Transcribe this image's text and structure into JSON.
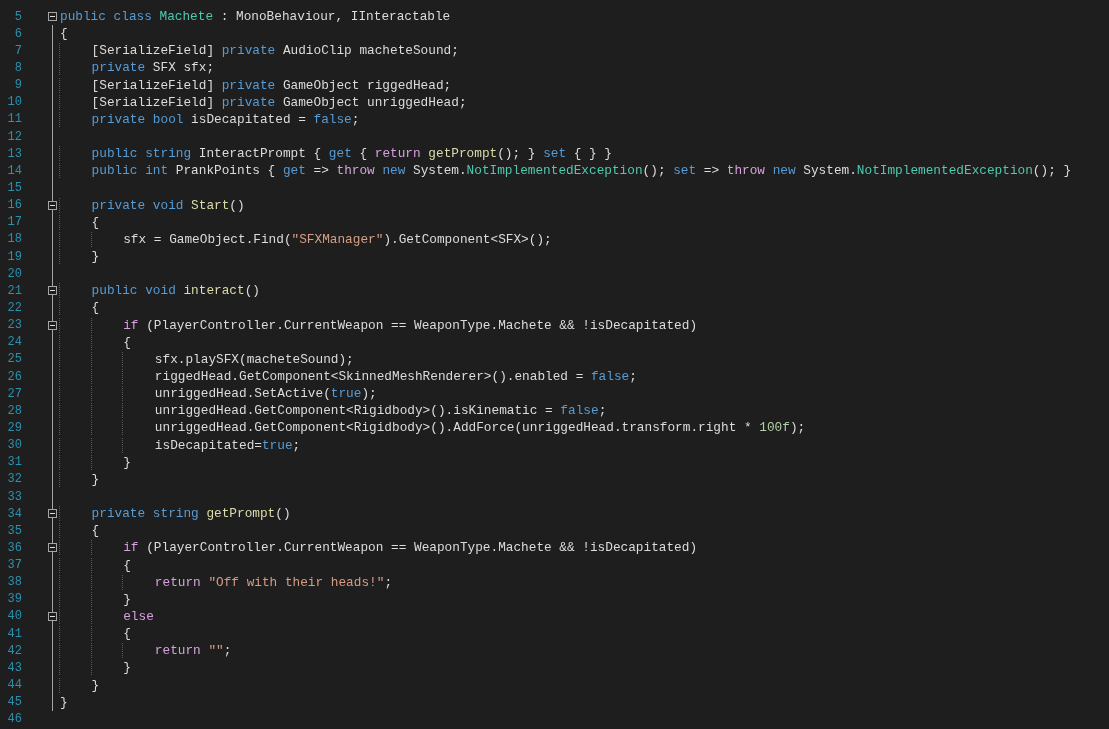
{
  "editor": {
    "lines": [
      {
        "number": "5",
        "fold_marker": true,
        "tokens": [
          {
            "kind": "keyword",
            "text": "public"
          },
          {
            "kind": "keyword",
            "text": " class"
          },
          {
            "kind": "type",
            "text": " Machete"
          },
          {
            "kind": "plain",
            "text": " : MonoBehaviour, IInteractable"
          }
        ]
      },
      {
        "number": "6",
        "fold_marker": false,
        "tokens": [
          {
            "kind": "plain",
            "text": "{"
          }
        ]
      },
      {
        "number": "7",
        "fold_marker": false,
        "tokens": [
          {
            "kind": "plain",
            "text": "    [SerializeField]"
          },
          {
            "kind": "keyword",
            "text": " private"
          },
          {
            "kind": "plain",
            "text": " AudioClip macheteSound;"
          }
        ]
      },
      {
        "number": "8",
        "fold_marker": false,
        "tokens": [
          {
            "kind": "keyword",
            "text": "    private"
          },
          {
            "kind": "plain",
            "text": " SFX sfx;"
          }
        ]
      },
      {
        "number": "9",
        "fold_marker": false,
        "tokens": [
          {
            "kind": "plain",
            "text": "    [SerializeField]"
          },
          {
            "kind": "keyword",
            "text": " private"
          },
          {
            "kind": "plain",
            "text": " GameObject riggedHead;"
          }
        ]
      },
      {
        "number": "10",
        "fold_marker": false,
        "tokens": [
          {
            "kind": "plain",
            "text": "    [SerializeField]"
          },
          {
            "kind": "keyword",
            "text": " private"
          },
          {
            "kind": "plain",
            "text": " GameObject unriggedHead;"
          }
        ]
      },
      {
        "number": "11",
        "fold_marker": false,
        "tokens": [
          {
            "kind": "keyword",
            "text": "    private"
          },
          {
            "kind": "keyword",
            "text": " bool"
          },
          {
            "kind": "plain",
            "text": " isDecapitated = "
          },
          {
            "kind": "keyword",
            "text": "false"
          },
          {
            "kind": "plain",
            "text": ";"
          }
        ]
      },
      {
        "number": "12",
        "fold_marker": false
      },
      {
        "number": "13",
        "fold_marker": false,
        "tokens": [
          {
            "kind": "keyword",
            "text": "    public"
          },
          {
            "kind": "keyword",
            "text": " string"
          },
          {
            "kind": "plain",
            "text": " InteractPrompt { "
          },
          {
            "kind": "keyword",
            "text": "get"
          },
          {
            "kind": "plain",
            "text": " { "
          },
          {
            "kind": "control",
            "text": "return"
          },
          {
            "kind": "method",
            "text": " getPrompt"
          },
          {
            "kind": "plain",
            "text": "(); } "
          },
          {
            "kind": "keyword",
            "text": "set"
          },
          {
            "kind": "plain",
            "text": " { } }"
          }
        ]
      },
      {
        "number": "14",
        "fold_marker": false,
        "tokens": [
          {
            "kind": "keyword",
            "text": "    public"
          },
          {
            "kind": "keyword",
            "text": " int"
          },
          {
            "kind": "plain",
            "text": " PrankPoints { "
          },
          {
            "kind": "keyword",
            "text": "get"
          },
          {
            "kind": "plain",
            "text": " => "
          },
          {
            "kind": "control",
            "text": "throw"
          },
          {
            "kind": "keyword",
            "text": " new"
          },
          {
            "kind": "plain",
            "text": " System."
          },
          {
            "kind": "type",
            "text": "NotImplementedException"
          },
          {
            "kind": "plain",
            "text": "(); "
          },
          {
            "kind": "keyword",
            "text": "set"
          },
          {
            "kind": "plain",
            "text": " => "
          },
          {
            "kind": "control",
            "text": "throw"
          },
          {
            "kind": "keyword",
            "text": " new"
          },
          {
            "kind": "plain",
            "text": " System."
          },
          {
            "kind": "type",
            "text": "NotImplementedException"
          },
          {
            "kind": "plain",
            "text": "(); }"
          }
        ]
      },
      {
        "number": "15",
        "fold_marker": false
      },
      {
        "number": "16",
        "fold_marker": true,
        "tokens": [
          {
            "kind": "keyword",
            "text": "    private"
          },
          {
            "kind": "keyword",
            "text": " void"
          },
          {
            "kind": "method",
            "text": " Start"
          },
          {
            "kind": "plain",
            "text": "()"
          }
        ]
      },
      {
        "number": "17",
        "fold_marker": false,
        "tokens": [
          {
            "kind": "plain",
            "text": "    {"
          }
        ]
      },
      {
        "number": "18",
        "fold_marker": false,
        "tokens": [
          {
            "kind": "plain",
            "text": "        sfx = GameObject.Find("
          },
          {
            "kind": "string",
            "text": "\"SFXManager\""
          },
          {
            "kind": "plain",
            "text": ").GetComponent<SFX>();"
          }
        ]
      },
      {
        "number": "19",
        "fold_marker": false,
        "tokens": [
          {
            "kind": "plain",
            "text": "    }"
          }
        ]
      },
      {
        "number": "20",
        "fold_marker": false
      },
      {
        "number": "21",
        "fold_marker": true,
        "tokens": [
          {
            "kind": "keyword",
            "text": "    public"
          },
          {
            "kind": "keyword",
            "text": " void"
          },
          {
            "kind": "method",
            "text": " interact"
          },
          {
            "kind": "plain",
            "text": "()"
          }
        ]
      },
      {
        "number": "22",
        "fold_marker": false,
        "tokens": [
          {
            "kind": "plain",
            "text": "    {"
          }
        ]
      },
      {
        "number": "23",
        "fold_marker": true,
        "tokens": [
          {
            "kind": "control",
            "text": "        if"
          },
          {
            "kind": "plain",
            "text": " (PlayerController.CurrentWeapon == WeaponType.Machete && !isDecapitated)"
          }
        ]
      },
      {
        "number": "24",
        "fold_marker": false,
        "tokens": [
          {
            "kind": "plain",
            "text": "        {"
          }
        ]
      },
      {
        "number": "25",
        "fold_marker": false,
        "tokens": [
          {
            "kind": "plain",
            "text": "            sfx.playSFX(macheteSound);"
          }
        ]
      },
      {
        "number": "26",
        "fold_marker": false,
        "tokens": [
          {
            "kind": "plain",
            "text": "            riggedHead.GetComponent<SkinnedMeshRenderer>().enabled = "
          },
          {
            "kind": "keyword",
            "text": "false"
          },
          {
            "kind": "plain",
            "text": ";"
          }
        ]
      },
      {
        "number": "27",
        "fold_marker": false,
        "tokens": [
          {
            "kind": "plain",
            "text": "            unriggedHead.SetActive("
          },
          {
            "kind": "keyword",
            "text": "true"
          },
          {
            "kind": "plain",
            "text": ");"
          }
        ]
      },
      {
        "number": "28",
        "fold_marker": false,
        "tokens": [
          {
            "kind": "plain",
            "text": "            unriggedHead.GetComponent<Rigidbody>().isKinematic = "
          },
          {
            "kind": "keyword",
            "text": "false"
          },
          {
            "kind": "plain",
            "text": ";"
          }
        ]
      },
      {
        "number": "29",
        "fold_marker": false,
        "tokens": [
          {
            "kind": "plain",
            "text": "            unriggedHead.GetComponent<Rigidbody>().AddForce(unriggedHead.transform.right * "
          },
          {
            "kind": "number",
            "text": "100f"
          },
          {
            "kind": "plain",
            "text": ");"
          }
        ]
      },
      {
        "number": "30",
        "fold_marker": false,
        "tokens": [
          {
            "kind": "plain",
            "text": "            isDecapitated="
          },
          {
            "kind": "keyword",
            "text": "true"
          },
          {
            "kind": "plain",
            "text": ";"
          }
        ]
      },
      {
        "number": "31",
        "fold_marker": false,
        "tokens": [
          {
            "kind": "plain",
            "text": "        }"
          }
        ]
      },
      {
        "number": "32",
        "fold_marker": false,
        "tokens": [
          {
            "kind": "plain",
            "text": "    }"
          }
        ]
      },
      {
        "number": "33",
        "fold_marker": false
      },
      {
        "number": "34",
        "fold_marker": true,
        "tokens": [
          {
            "kind": "keyword",
            "text": "    private"
          },
          {
            "kind": "keyword",
            "text": " string"
          },
          {
            "kind": "method",
            "text": " getPrompt"
          },
          {
            "kind": "plain",
            "text": "()"
          }
        ]
      },
      {
        "number": "35",
        "fold_marker": false,
        "tokens": [
          {
            "kind": "plain",
            "text": "    {"
          }
        ]
      },
      {
        "number": "36",
        "fold_marker": true,
        "tokens": [
          {
            "kind": "control",
            "text": "        if"
          },
          {
            "kind": "plain",
            "text": " (PlayerController.CurrentWeapon == WeaponType.Machete && !isDecapitated)"
          }
        ]
      },
      {
        "number": "37",
        "fold_marker": false,
        "tokens": [
          {
            "kind": "plain",
            "text": "        {"
          }
        ]
      },
      {
        "number": "38",
        "fold_marker": false,
        "tokens": [
          {
            "kind": "control",
            "text": "            return"
          },
          {
            "kind": "string",
            "text": " \"Off with their heads!\""
          },
          {
            "kind": "plain",
            "text": ";"
          }
        ]
      },
      {
        "number": "39",
        "fold_marker": false,
        "tokens": [
          {
            "kind": "plain",
            "text": "        }"
          }
        ]
      },
      {
        "number": "40",
        "fold_marker": true,
        "tokens": [
          {
            "kind": "control",
            "text": "        else"
          }
        ]
      },
      {
        "number": "41",
        "fold_marker": false,
        "tokens": [
          {
            "kind": "plain",
            "text": "        {"
          }
        ]
      },
      {
        "number": "42",
        "fold_marker": false,
        "tokens": [
          {
            "kind": "control",
            "text": "            return"
          },
          {
            "kind": "string",
            "text": " \"\""
          },
          {
            "kind": "plain",
            "text": ";"
          }
        ]
      },
      {
        "number": "43",
        "fold_marker": false,
        "tokens": [
          {
            "kind": "plain",
            "text": "        }"
          }
        ]
      },
      {
        "number": "44",
        "fold_marker": false,
        "tokens": [
          {
            "kind": "plain",
            "text": "    }"
          }
        ]
      },
      {
        "number": "45",
        "fold_marker": false,
        "tokens": [
          {
            "kind": "plain",
            "text": "}"
          }
        ]
      },
      {
        "number": "46",
        "fold_marker": false
      }
    ]
  }
}
